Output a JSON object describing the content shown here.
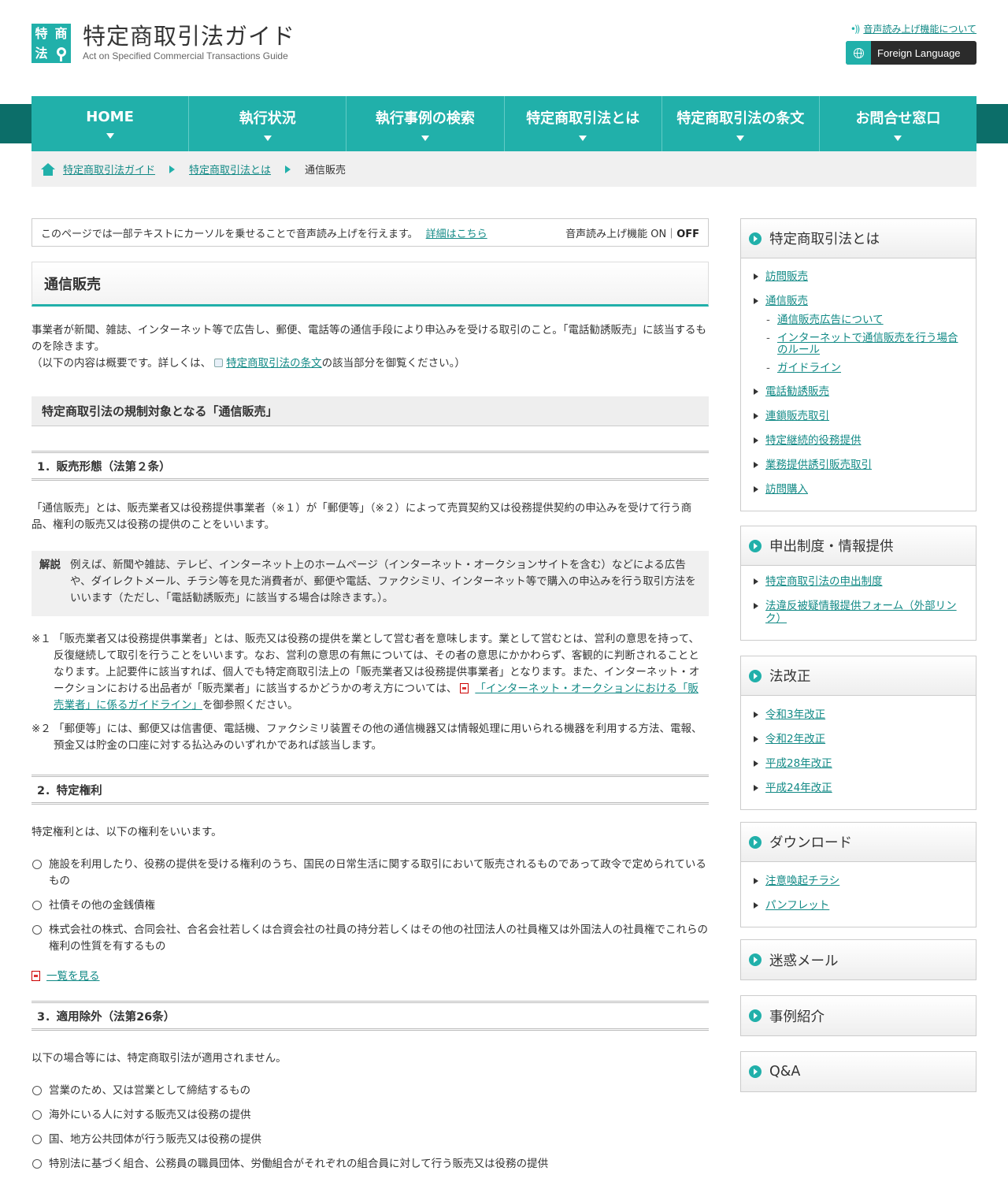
{
  "header": {
    "logo_chars": [
      "特",
      "商",
      "法"
    ],
    "site_title": "特定商取引法ガイド",
    "site_subtitle": "Act on Specified Commercial Transactions Guide",
    "voice_link": "音声読み上げ機能について",
    "language_button": "Foreign Language"
  },
  "nav": {
    "items": [
      "HOME",
      "執行状況",
      "執行事例の検索",
      "特定商取引法とは",
      "特定商取引法の条文",
      "お問合せ窓口"
    ]
  },
  "breadcrumb": {
    "items": [
      "特定商取引法ガイド",
      "特定商取引法とは"
    ],
    "current": "通信販売"
  },
  "notice": {
    "text": "このページでは一部テキストにカーソルを乗せることで音声読み上げを行えます。",
    "link": "詳細はこちら",
    "toggle_label": "音声読み上げ機能 ON｜",
    "toggle_state": "OFF"
  },
  "page": {
    "title": "通信販売",
    "intro_line1": "事業者が新聞、雑誌、インターネット等で広告し、郵便、電話等の通信手段により申込みを受ける取引のこと。「電話勧誘販売」に該当するものを除きます。",
    "intro_line2_pre": "（以下の内容は概要です。詳しくは、",
    "intro_line2_link": "特定商取引法の条文",
    "intro_line2_post": "の該当部分を御覧ください。）",
    "section_title": "特定商取引法の規制対象となる「通信販売」",
    "s1": {
      "heading": "1．販売形態（法第２条）",
      "body": "「通信販売」とは、販売業者又は役務提供事業者（※１）が「郵便等」（※２）によって売買契約又は役務提供契約の申込みを受けて行う商品、権利の販売又は役務の提供のことをいいます。",
      "kaisetsu_label": "解説",
      "kaisetsu_text": "例えば、新聞や雑誌、テレビ、インターネット上のホームページ（インターネット・オークションサイトを含む）などによる広告や、ダイレクトメール、チラシ等を見た消費者が、郵便や電話、ファクシミリ、インターネット等で購入の申込みを行う取引方法をいいます（ただし、「電話勧誘販売」に該当する場合は除きます。）。",
      "note1_mark": "※１",
      "note1_text": "「販売業者又は役務提供事業者」とは、販売又は役務の提供を業として営む者を意味します。業として営むとは、営利の意思を持って、反復継続して取引を行うことをいいます。なお、営利の意思の有無については、その者の意思にかかわらず、客観的に判断されることとなります。上記要件に該当すれば、個人でも特定商取引法上の「販売業者又は役務提供事業者」となります。また、インターネット・オークションにおける出品者が「販売業者」に該当するかどうかの考え方については、",
      "note1_link": "「インターネット・オークションにおける「販売業者」に係るガイドライン」",
      "note1_post": "を御参照ください。",
      "note2_mark": "※２",
      "note2_text": "「郵便等」には、郵便又は信書便、電話機、ファクシミリ装置その他の通信機器又は情報処理に用いられる機器を利用する方法、電報、預金又は貯金の口座に対する払込みのいずれかであれば該当します。"
    },
    "s2": {
      "heading": "2．特定権利",
      "body": "特定権利とは、以下の権利をいいます。",
      "items": [
        "施設を利用したり、役務の提供を受ける権利のうち、国民の日常生活に関する取引において販売されるものであって政令で定められているもの",
        "社債その他の金銭債権",
        "株式会社の株式、合同会社、合名会社若しくは合資会社の社員の持分若しくはその他の社団法人の社員権又は外国法人の社員権でこれらの権利の性質を有するもの"
      ],
      "list_link": "一覧を見る"
    },
    "s3": {
      "heading": "3．適用除外（法第26条）",
      "body": "以下の場合等には、特定商取引法が適用されません。",
      "items": [
        "営業のため、又は営業として締結するもの",
        "海外にいる人に対する販売又は役務の提供",
        "国、地方公共団体が行う販売又は役務の提供",
        "特別法に基づく組合、公務員の職員団体、労働組合がそれぞれの組合員に対して行う販売又は役務の提供"
      ]
    }
  },
  "sidebar": {
    "box1": {
      "title": "特定商取引法とは",
      "items": [
        "訪問販売",
        "通信販売"
      ],
      "subitems": [
        "通信販売広告について",
        "インターネットで通信販売を行う場合のルール",
        "ガイドライン"
      ],
      "items_after": [
        "電話勧誘販売",
        "連鎖販売取引",
        "特定継続的役務提供",
        "業務提供誘引販売取引",
        "訪問購入"
      ]
    },
    "box2": {
      "title": "申出制度・情報提供",
      "items": [
        "特定商取引法の申出制度",
        "法違反被疑情報提供フォーム（外部リンク）"
      ]
    },
    "box3": {
      "title": "法改正",
      "items": [
        "令和3年改正",
        "令和2年改正",
        "平成28年改正",
        "平成24年改正"
      ]
    },
    "box4": {
      "title": "ダウンロード",
      "items": [
        "注意喚起チラシ",
        "パンフレット"
      ]
    },
    "box5": {
      "title": "迷惑メール"
    },
    "box6": {
      "title": "事例紹介"
    },
    "box7": {
      "title": "Q&A"
    }
  }
}
